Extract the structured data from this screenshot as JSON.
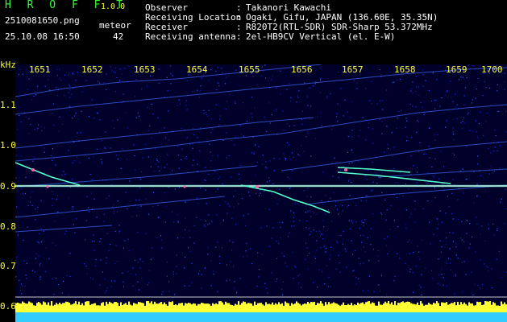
{
  "header": {
    "app_name": "H R O F F T",
    "version": "1.0.0",
    "filename": "2510081650.png",
    "meteor_label": "meteor",
    "datetime": "25.10.08 16:50",
    "meteor_count": "42"
  },
  "info": [
    {
      "key": "Observer",
      "value": "Takanori Kawachi"
    },
    {
      "key": "Receiving Location",
      "value": "Ogaki, Gifu, JAPAN (136.60E, 35.35N)"
    },
    {
      "key": "Receiver",
      "value": "R820T2(RTL-SDR) SDR-Sharp 53.372MHz"
    },
    {
      "key": "Receiving antenna",
      "value": "2el-HB9CV Vertical (el. E-W)"
    }
  ],
  "spectrogram": {
    "unit_label": "kHz",
    "time_labels": [
      "1651",
      "1652",
      "1653",
      "1654",
      "1655",
      "1656",
      "1657",
      "1658",
      "1659",
      "1700"
    ],
    "freq_labels": [
      "1.1",
      "1.0",
      "0.9",
      "0.8",
      "0.7",
      "0.6"
    ],
    "colors": {
      "background": "#00002a",
      "trace": "#55ffcc",
      "carrier": "#ffffff",
      "level": "#ffff33",
      "level_low": "#33ccff"
    }
  }
}
